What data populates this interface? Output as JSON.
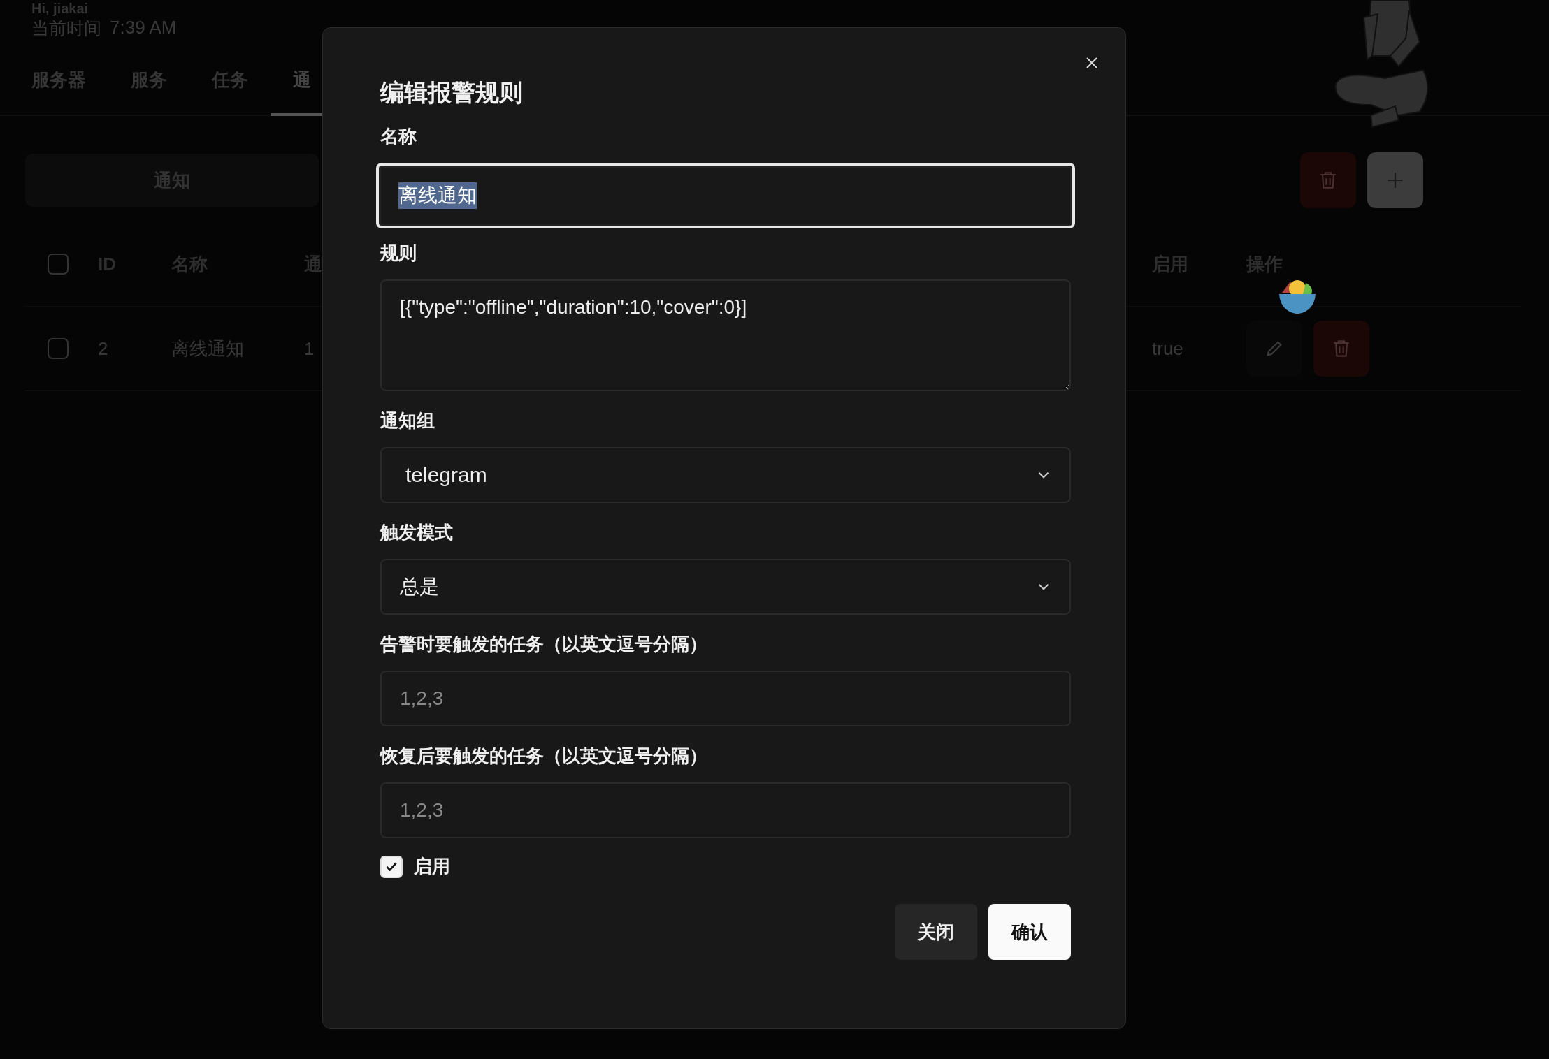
{
  "header": {
    "greeting": "Hi, jiakai",
    "time_label": "当前时间",
    "time": "7:39 AM"
  },
  "nav_tabs": [
    {
      "label": "服务器",
      "selected": false
    },
    {
      "label": "服务",
      "selected": false
    },
    {
      "label": "任务",
      "selected": false
    },
    {
      "label": "通",
      "selected": true
    }
  ],
  "segment": {
    "label": "通知"
  },
  "table": {
    "header_checked": false,
    "columns": [
      "ID",
      "名称",
      "通",
      "启用",
      "操作"
    ],
    "rows": [
      {
        "selected": false,
        "id": "2",
        "name": "离线通知",
        "column_3": "1",
        "enabled": "true"
      }
    ]
  },
  "dialog": {
    "title": "编辑报警规则",
    "fields": [
      {
        "kind": "input",
        "label": "名称",
        "value": "离线通知",
        "focused": true,
        "text_selected": true
      },
      {
        "kind": "textarea",
        "label": "规则",
        "value": "[{\"type\":\"offline\",\"duration\":10,\"cover\":0}]"
      },
      {
        "kind": "select",
        "label": "通知组",
        "value": "telegram"
      },
      {
        "kind": "select",
        "label": "触发模式",
        "value": "总是"
      },
      {
        "kind": "input",
        "label": "告警时要触发的任务（以英文逗号分隔）",
        "placeholder": "1,2,3"
      },
      {
        "kind": "input",
        "label": "恢复后要触发的任务（以英文逗号分隔）",
        "placeholder": "1,2,3"
      }
    ],
    "checkbox": {
      "label": "启用",
      "checked": true
    },
    "buttons": [
      {
        "label": "关闭",
        "kind": "secondary"
      },
      {
        "label": "确认",
        "kind": "primary"
      }
    ]
  }
}
